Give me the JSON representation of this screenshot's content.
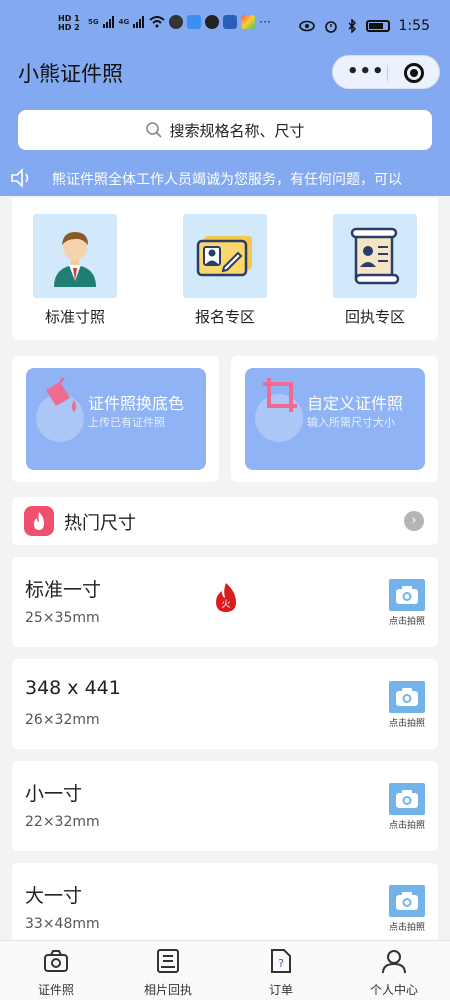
{
  "status_bar": {
    "sim": "HD 1\nHD 2",
    "net1": "5G",
    "net2": "4G",
    "time": "1:55"
  },
  "header": {
    "title": "小熊证件照",
    "more_icon": "more-dots-icon",
    "close_icon": "target-circle-icon"
  },
  "search": {
    "placeholder": "搜索规格名称、尺寸"
  },
  "notice": {
    "text": "熊证件照全体工作人员竭诚为您服务，有任何问题，可以"
  },
  "categories": [
    {
      "label": "标准寸照",
      "icon": "person-avatar-icon"
    },
    {
      "label": "报名专区",
      "icon": "id-card-icon"
    },
    {
      "label": "回执专区",
      "icon": "scroll-receipt-icon"
    }
  ],
  "features": [
    {
      "title": "证件照换底色",
      "subtitle": "上传已有证件照",
      "icon": "paint-bucket-icon"
    },
    {
      "title": "自定义证件照",
      "subtitle": "输入所需尺寸大小",
      "icon": "crop-icon"
    }
  ],
  "hot": {
    "title": "热门尺寸",
    "fire_badge": "火"
  },
  "sizes": [
    {
      "name": "标准一寸",
      "dims": "25×35mm",
      "action": "点击拍照",
      "hot": true
    },
    {
      "name": "348 x 441",
      "dims": "26×32mm",
      "action": "点击拍照",
      "hot": false
    },
    {
      "name": "小一寸",
      "dims": "22×32mm",
      "action": "点击拍照",
      "hot": false
    },
    {
      "name": "大一寸",
      "dims": "33×48mm",
      "action": "点击拍照",
      "hot": false
    }
  ],
  "tabbar": [
    {
      "label": "证件照",
      "icon": "camera-icon"
    },
    {
      "label": "相片回执",
      "icon": "receipt-icon"
    },
    {
      "label": "订单",
      "icon": "order-document-icon"
    },
    {
      "label": "个人中心",
      "icon": "user-icon"
    }
  ],
  "colors": {
    "header_bg": "#83aaf0",
    "feature_bg": "#8fb3f4",
    "tile_bg": "#d2e8fb",
    "camera_bg": "#74b3ea",
    "hot_icon_bg": "#f0506e"
  }
}
